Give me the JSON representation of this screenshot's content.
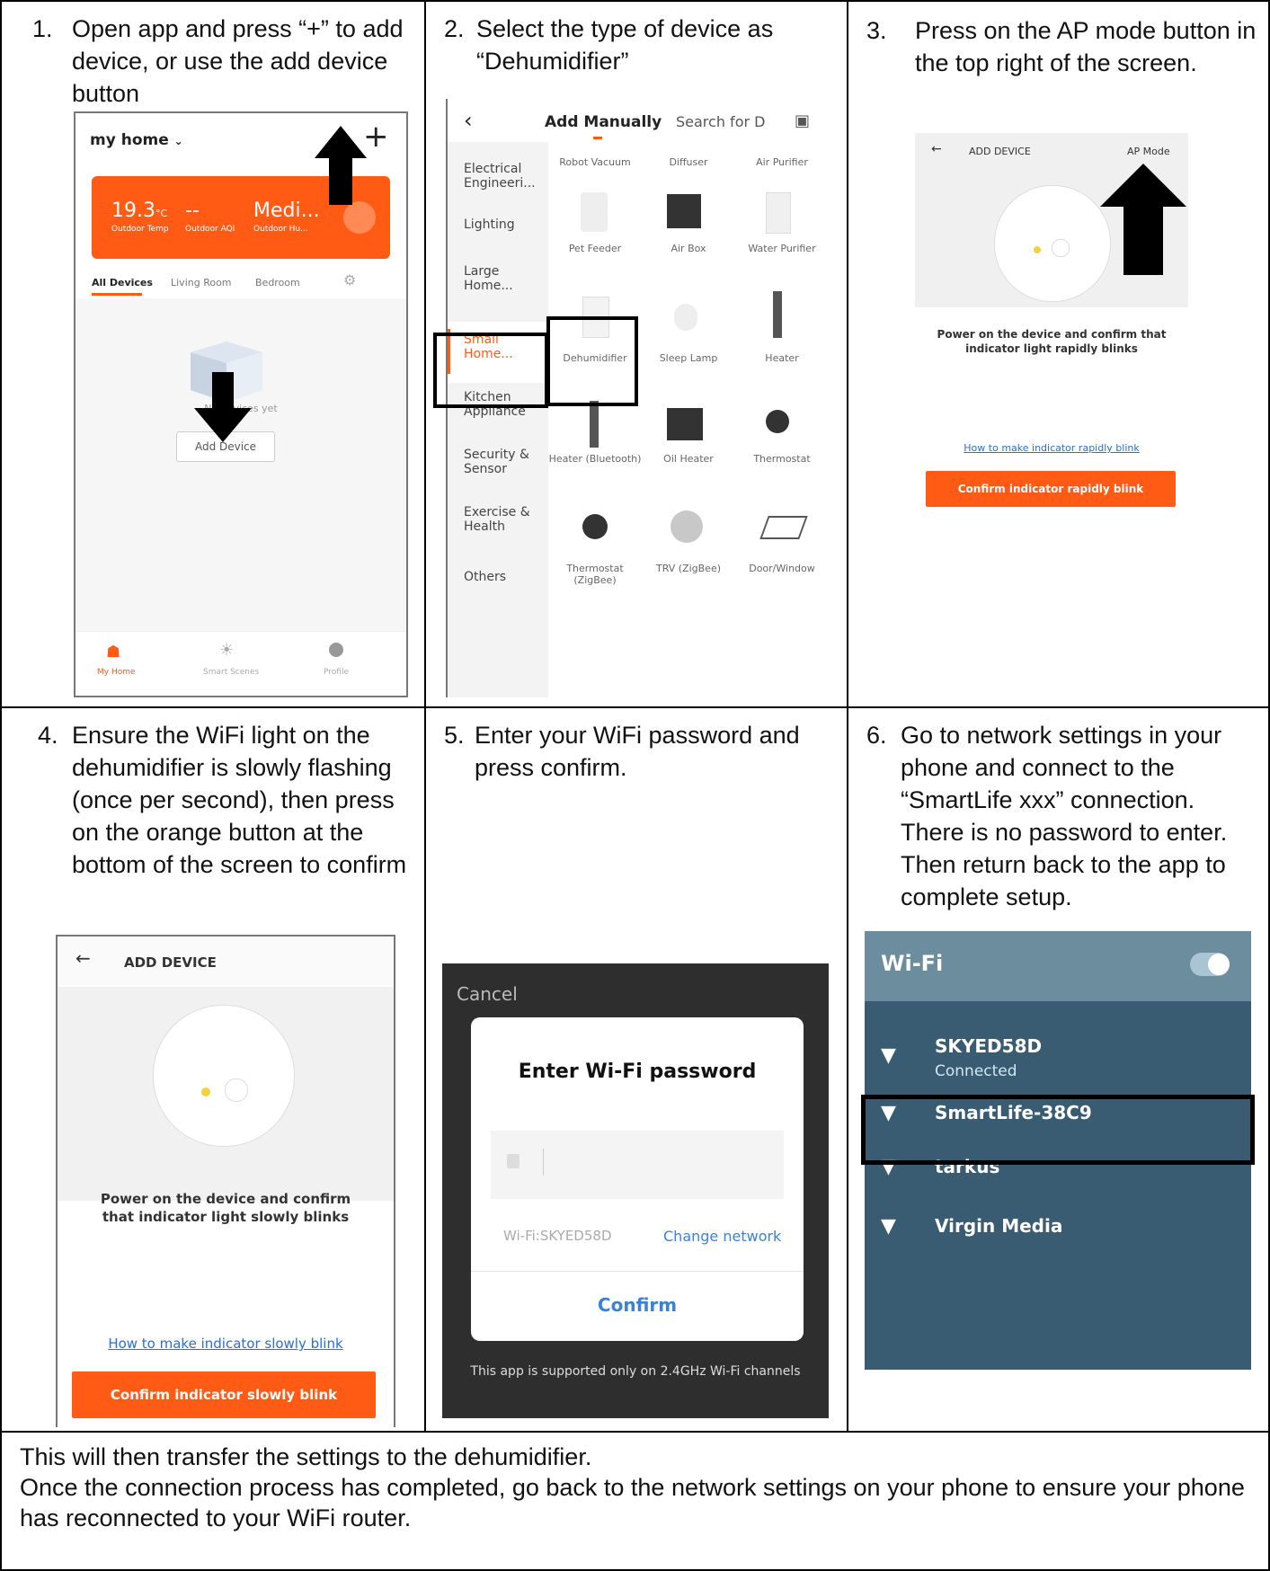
{
  "steps": {
    "s1": {
      "num": "1.",
      "text": "Open app and press “+” to add device, or use the add device button"
    },
    "s2": {
      "num": "2.",
      "text": "Select the type of device as “Dehumidifier”"
    },
    "s3": {
      "num": "3.",
      "text": "Press on the AP mode button in the top right of the screen."
    },
    "s4": {
      "num": "4.",
      "text": "Ensure the WiFi light on the dehumidifier is slowly flashing (once per second), then press on the orange button at the bottom of the screen to confirm"
    },
    "s5": {
      "num": "5.",
      "text": "Enter your WiFi password and press confirm."
    },
    "s6": {
      "num": "6.",
      "text": "Go to network settings in your phone and connect to the “SmartLife xxx” connection. There is no password to enter. Then return back to the app to complete setup."
    }
  },
  "footer": {
    "line1": "This will then transfer the settings to the dehumidifier.",
    "line2": "Once the connection process has completed, go back to the network settings on your phone to ensure your phone has reconnected to your WiFi router."
  },
  "screen1": {
    "home_name": "my home",
    "plus": "+",
    "temp": "19.3",
    "temp_unit": "°C",
    "aqi": "--",
    "hum": "Medi...",
    "temp_label": "Outdoor Temp",
    "aqi_label": "Outdoor AQI",
    "hum_label": "Outdoor Hu...",
    "tabs": [
      "All Devices",
      "Living Room",
      "Bedroom"
    ],
    "empty_text": "No devices yet",
    "add_device": "Add Device",
    "nav": [
      "My Home",
      "Smart Scenes",
      "Profile"
    ],
    "colors": {
      "accent": "#ff5b14"
    }
  },
  "screen2": {
    "title": "Add Manually",
    "search": "Search for D",
    "categories": [
      "Electrical Engineeri...",
      "Lighting",
      "Large Home...",
      "Small Home...",
      "Kitchen Appliance",
      "Security & Sensor",
      "Exercise & Health",
      "Others"
    ],
    "devices_row1": [
      "Robot Vacuum",
      "Diffuser",
      "Air Purifier"
    ],
    "devices_row2": [
      "Pet Feeder",
      "Air Box",
      "Water Purifier"
    ],
    "devices_row3": [
      "Dehumidifier",
      "Sleep Lamp",
      "Heater"
    ],
    "devices_row4": [
      "Heater (Bluetooth)",
      "Oil Heater",
      "Thermostat"
    ],
    "devices_row5": [
      "Thermostat (ZigBee)",
      "TRV (ZigBee)",
      "Door/Window"
    ]
  },
  "screen3": {
    "title": "ADD DEVICE",
    "ap_mode": "AP Mode",
    "instruction": "Power on the device and confirm that indicator light rapidly blinks",
    "link": "How to make indicator rapidly blink",
    "button": "Confirm indicator rapidly blink"
  },
  "screen4": {
    "title": "ADD DEVICE",
    "instruction": "Power on the device and confirm that indicator light slowly blinks",
    "link": "How to make indicator slowly blink",
    "button": "Confirm indicator slowly blink"
  },
  "screen5": {
    "cancel": "Cancel",
    "dialog_title": "Enter Wi-Fi password",
    "wifi_label": "Wi-Fi:SKYED58D",
    "change_network": "Change network",
    "confirm": "Confirm",
    "note": "This app is supported only on 2.4GHz Wi-Fi channels"
  },
  "screen6": {
    "title": "Wi-Fi",
    "networks": [
      {
        "name": "SKYED58D",
        "status": "Connected"
      },
      {
        "name": "SmartLife-38C9",
        "status": ""
      },
      {
        "name": "tarkus",
        "status": ""
      },
      {
        "name": "Virgin Media",
        "status": ""
      }
    ]
  }
}
